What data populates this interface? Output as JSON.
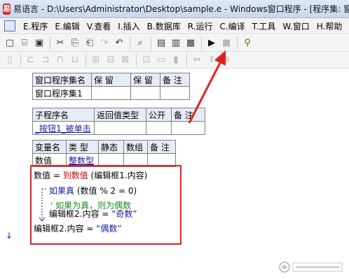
{
  "titlebar": {
    "app_icon": "app-logo-icon",
    "title": "易语言 - D:\\Users\\Administrator\\Desktop\\sample.e - Windows窗口程序 - [程序集: 窗"
  },
  "menubar": {
    "items": [
      "E.程序",
      "E.编辑",
      "V.查看",
      "I.插入",
      "B.数据库",
      "R.运行",
      "C.编译",
      "T.工具",
      "W.窗口",
      "H.帮助"
    ]
  },
  "toolbar1": {
    "buttons": [
      {
        "icon": "new-file-icon",
        "glyph": "▢"
      },
      {
        "icon": "open-folder-icon",
        "glyph": "⌸"
      },
      {
        "icon": "save-icon",
        "glyph": "▣"
      },
      {
        "icon": "cut-icon",
        "glyph": "✂"
      },
      {
        "icon": "copy-icon",
        "glyph": "⎘"
      },
      {
        "icon": "paste-icon",
        "glyph": "⎗"
      },
      {
        "icon": "redo-icon",
        "glyph": "↷"
      },
      {
        "icon": "undo-icon",
        "glyph": "↶"
      },
      {
        "icon": "find-icon",
        "glyph": "⌕"
      },
      {
        "icon": "layout1-icon",
        "glyph": "▤"
      },
      {
        "icon": "layout2-icon",
        "glyph": "▥"
      },
      {
        "icon": "layout3-icon",
        "glyph": "▦"
      },
      {
        "icon": "run-icon",
        "glyph": "▶"
      },
      {
        "icon": "stop-icon",
        "glyph": "■"
      },
      {
        "icon": "binoculars-icon",
        "glyph": "⚲"
      }
    ]
  },
  "toolbar2": {
    "buttons": [
      "align-left-icon",
      "align-1-icon",
      "align-2-icon",
      "align-3-icon",
      "align-4-icon",
      "align-5-icon",
      "align-6-icon",
      "align-7-icon",
      "align-8-icon",
      "align-9-icon",
      "align-10-icon",
      "space-h-icon",
      "space-v-icon",
      "center-icon"
    ]
  },
  "assembly_table": {
    "headers": [
      "窗口程序集名",
      "保 留",
      "保 留",
      "备 注"
    ],
    "row": [
      "窗口程序集1",
      "",
      "",
      ""
    ]
  },
  "sub_table": {
    "headers": [
      "子程序名",
      "返回值类型",
      "公开",
      "备 注"
    ],
    "row": [
      "_按钮1_被单击",
      "",
      "",
      ""
    ]
  },
  "var_table": {
    "headers": [
      "变量名",
      "类 型",
      "静态",
      "数组",
      "备 注"
    ],
    "row": [
      "数值",
      "整数型",
      "",
      "",
      ""
    ]
  },
  "code": {
    "line1_a": "数值 = ",
    "line1_b": "到数值",
    "line1_c": " (编辑框1.内容)",
    "line2_a": "如果真",
    "line2_b": " (数值 % 2 = 0)",
    "line3": "' 如果为真，则为偶数",
    "line4_a": "编辑框2.内容 = ",
    "line4_b": "“奇数”",
    "line5_a": "编辑框2.内容 = ",
    "line5_b": "“偶数”"
  },
  "marker": "↓",
  "watermark": "watermark-logo",
  "colors": {
    "highlight": "#e02020",
    "keyword": "#1a1aa6",
    "command": "#c00000",
    "comment": "#1f8a1f"
  }
}
